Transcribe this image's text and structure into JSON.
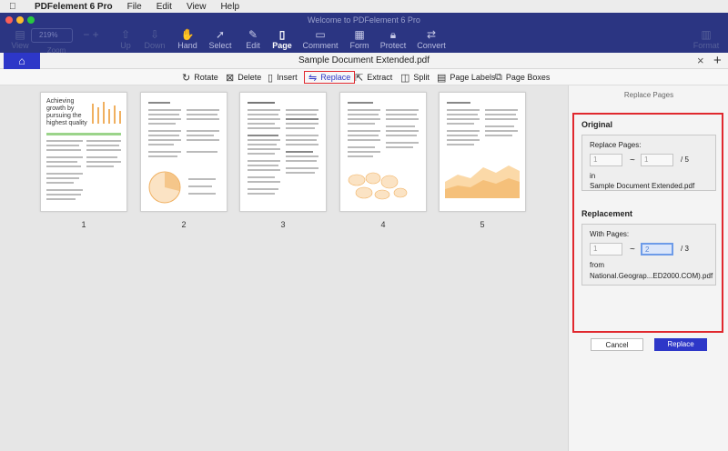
{
  "menubar": {
    "apple_icon": "apple-icon",
    "items": [
      "PDFelement 6 Pro",
      "File",
      "Edit",
      "View",
      "Help"
    ]
  },
  "window": {
    "title": "Welcome to PDFelement 6 Pro",
    "zoom": "219%"
  },
  "toolbar": {
    "view": "View",
    "zoom": "Zoom",
    "up": "Up",
    "down": "Down",
    "hand": "Hand",
    "select": "Select",
    "edit": "Edit",
    "page": "Page",
    "comment": "Comment",
    "form": "Form",
    "protect": "Protect",
    "convert": "Convert",
    "format": "Format"
  },
  "tab": {
    "doc_title": "Sample Document Extended.pdf",
    "close": "×",
    "add": "+"
  },
  "page_toolbar": {
    "rotate": "Rotate",
    "delete": "Delete",
    "insert": "Insert",
    "replace": "Replace",
    "extract": "Extract",
    "split": "Split",
    "page_labels": "Page Labels",
    "page_boxes": "Page Boxes"
  },
  "thumbnails": {
    "p1": "1",
    "p2": "2",
    "p3": "3",
    "p4": "4",
    "p5": "5",
    "p1_heading": "Achieving growth by pursuing the highest quality"
  },
  "panel": {
    "header": "Replace Pages",
    "original_title": "Original",
    "replace_pages_label": "Replace Pages:",
    "from_value": "1",
    "to_value": "1",
    "tilde": "~",
    "of_total": "/ 5",
    "in_label": "in",
    "source_file": "Sample Document Extended.pdf",
    "replacement_title": "Replacement",
    "with_pages_label": "With Pages:",
    "with_from": "1",
    "with_to": "2",
    "with_of_total": "/ 3",
    "from_label": "from",
    "replacement_file": "National.Geograp...ED2000.COM).pdf",
    "cancel": "Cancel",
    "replace": "Replace"
  },
  "colors": {
    "accent": "#2d37c8",
    "titlebar": "#2b3582",
    "highlight": "#e0282e"
  }
}
